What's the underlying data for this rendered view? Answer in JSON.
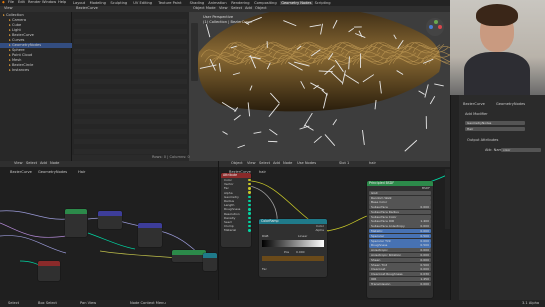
{
  "top_menu": {
    "items": [
      "File",
      "Edit",
      "Render",
      "Window",
      "Help"
    ],
    "workspace_tabs": [
      "Layout",
      "Modeling",
      "Sculpting",
      "UV Editing",
      "Texture Paint",
      "Shading",
      "Animation",
      "Rendering",
      "Compositing",
      "Geometry Nodes",
      "Scripting"
    ],
    "active_tab_index": 9,
    "scene_label": "BezierCurve"
  },
  "outliner": {
    "header": "View",
    "items": [
      "Collection",
      "Camera",
      "Cube",
      "Light",
      "BezierCurve",
      "Curves",
      "GeometryNodes",
      "Sphere",
      "Point Cloud",
      "Mesh",
      "BezierCircle",
      "Instances"
    ]
  },
  "viewport": {
    "header_items": [
      "Object Mode",
      "View",
      "Select",
      "Add",
      "Object"
    ],
    "overlay_lines": [
      "User Perspective",
      "(1) Collection | BezierCurve"
    ]
  },
  "spreadsheet_footer": {
    "left": "Rows: 0  |  Columns: 0"
  },
  "props_panel": {
    "object_name": "BezierCurve",
    "modifier_name": "GeometryNodes",
    "add_modifier": "Add Modifier",
    "modifier_field": "GeometryNodes",
    "tree_field": "Hair",
    "section": "Output Attributes",
    "attr_label": "Attr. Name",
    "attr_value": "color"
  },
  "node_editor_left": {
    "header_items": [
      "View",
      "Select",
      "Add",
      "Node"
    ],
    "breadcrumb": [
      "BezierCurve",
      "GeometryNodes",
      "Hair"
    ]
  },
  "node_editor_right": {
    "header_items": [
      "Object",
      "View",
      "Select",
      "Add",
      "Node",
      "Use Nodes"
    ],
    "slot_label": "Slot 1",
    "material": "hair",
    "breadcrumb": [
      "BezierCurve",
      "hair"
    ]
  },
  "attribute_node": {
    "title": "Attribute",
    "rows": [
      "Color",
      "Vector",
      "Fac",
      "Alpha"
    ]
  },
  "group_input_node": {
    "title": "Group Input",
    "rows": [
      "Geometry",
      "Radius",
      "Length",
      "Roughness",
      "Resolution",
      "Density",
      "Seed",
      "Clump",
      "Material"
    ]
  },
  "color_ramp_node": {
    "title": "ColorRamp",
    "outputs": [
      "Color",
      "Alpha"
    ],
    "mode": "RGB",
    "interp": "Linear",
    "pos_label": "Pos",
    "pos_value": "0.000",
    "fac_label": "Fac"
  },
  "principled_node": {
    "title": "Principled BSDF",
    "output": "BSDF",
    "rows": [
      "GGX",
      "Random Walk",
      "Base Color",
      "Subsurface",
      "Subsurface Radius",
      "Subsurface Color",
      "Subsurface IOR",
      "Subsurface Anisotropy",
      "Metallic",
      "Specular",
      "Specular Tint",
      "Roughness",
      "Anisotropic",
      "Anisotropic Rotation",
      "Sheen",
      "Sheen Tint",
      "Clearcoat",
      "Clearcoat Roughness",
      "IOR",
      "Transmission"
    ],
    "values": [
      "",
      "",
      "",
      "0.000",
      "",
      "",
      "1.400",
      "0.000",
      "0.000",
      "0.500",
      "0.000",
      "0.500",
      "0.000",
      "0.000",
      "0.000",
      "0.500",
      "0.000",
      "0.030",
      "1.450",
      "0.000"
    ]
  },
  "status_bar": {
    "left": "Select",
    "mid1": "Box Select",
    "mid2": "Pan View",
    "mid3": "Node Context Menu",
    "version": "3.1 Alpha"
  },
  "colors": {
    "accent": "#4772b3",
    "node_green": "#2c8a4a",
    "node_teal": "#1f7a8a",
    "node_red": "#8a2a2a",
    "hair": "#7a5a2a"
  }
}
